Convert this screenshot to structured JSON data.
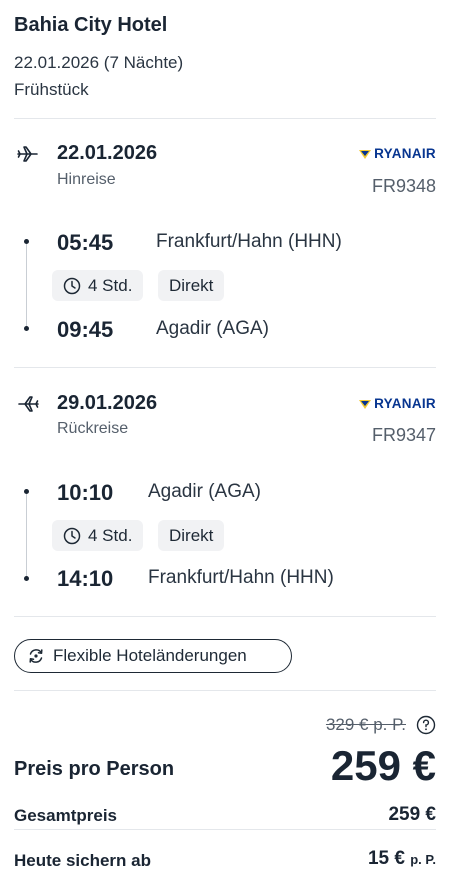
{
  "hotel": {
    "name": "Bahia City Hotel",
    "dates": "22.01.2026 (7 Nächte)",
    "board": "Frühstück"
  },
  "outbound": {
    "date": "22.01.2026",
    "kind": "Hinreise",
    "airline": "RYANAIR",
    "flight_number": "FR9348",
    "dep_time": "05:45",
    "dep_place": "Frankfurt/Hahn (HHN)",
    "duration": "4 Std.",
    "stops": "Direkt",
    "arr_time": "09:45",
    "arr_place": "Agadir (AGA)"
  },
  "return": {
    "date": "29.01.2026",
    "kind": "Rückreise",
    "airline": "RYANAIR",
    "flight_number": "FR9347",
    "dep_time": "10:10",
    "dep_place": "Agadir (AGA)",
    "duration": "4 Std.",
    "stops": "Direkt",
    "arr_time": "14:10",
    "arr_place": "Frankfurt/Hahn (HHN)"
  },
  "flex_option": "Flexible Hoteländerungen",
  "pricing": {
    "old_price": "329 € p. P.",
    "per_person_label": "Preis pro Person",
    "per_person_price": "259 €",
    "total_label": "Gesamtpreis",
    "total_price": "259 €",
    "deposit_label": "Heute sichern ab",
    "deposit_price": "15 €",
    "deposit_unit": "p. P."
  },
  "colors": {
    "airline_blue": "#073590",
    "airline_yellow": "#f1c933",
    "text": "#1a2533"
  }
}
